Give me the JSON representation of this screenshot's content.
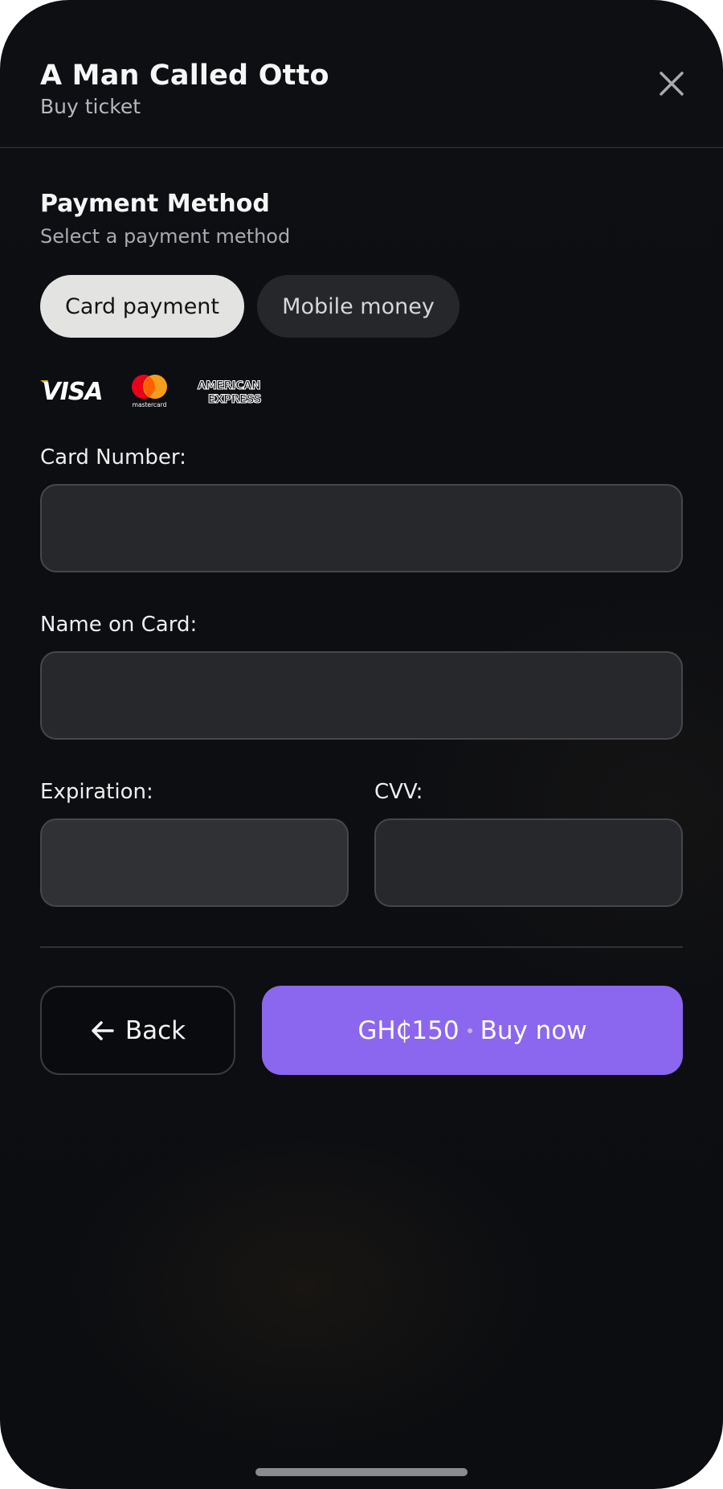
{
  "header": {
    "title": "A Man Called Otto",
    "subtitle": "Buy ticket",
    "close_icon": "close-icon"
  },
  "payment": {
    "title": "Payment Method",
    "subtitle": "Select a payment method",
    "methods": [
      {
        "label": "Card payment",
        "selected": true
      },
      {
        "label": "Mobile money",
        "selected": false
      }
    ],
    "card_logos": [
      {
        "name": "visa-logo",
        "text": "VISA"
      },
      {
        "name": "mastercard-logo",
        "text": "mastercard"
      },
      {
        "name": "american-express-logo",
        "text": "AMERICAN EXPRESS"
      }
    ]
  },
  "form": {
    "card_number": {
      "label": "Card Number:",
      "value": "",
      "placeholder": ""
    },
    "name_on_card": {
      "label": "Name on Card:",
      "value": "",
      "placeholder": ""
    },
    "expiration": {
      "label": "Expiration:",
      "value": "",
      "placeholder": ""
    },
    "cvv": {
      "label": "CVV:",
      "value": "",
      "placeholder": ""
    }
  },
  "actions": {
    "back_label": "Back",
    "back_icon": "arrow-left-icon",
    "price": "GH₵150",
    "buy_label": "Buy now"
  },
  "colors": {
    "accent": "#8b66ee",
    "background": "#0b0d10",
    "selected_pill": "#e3e4e2"
  }
}
